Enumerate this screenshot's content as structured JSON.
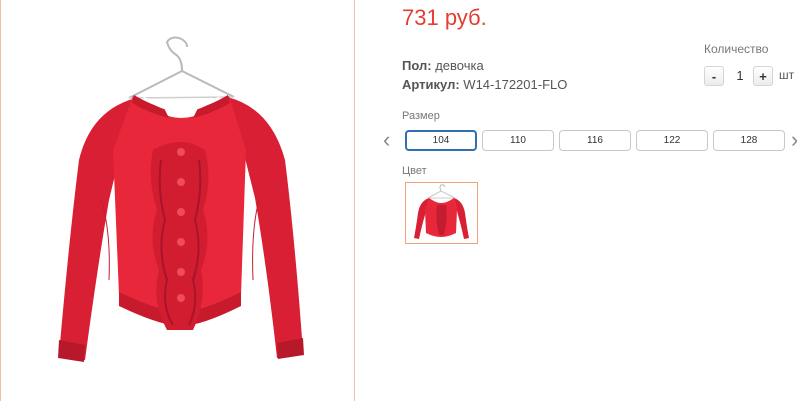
{
  "product": {
    "price": "731 руб.",
    "properties": [
      {
        "key": "Пол:",
        "value": "девочка"
      },
      {
        "key": "Артикул:",
        "value": "W14-172201-FLO"
      }
    ]
  },
  "quantity": {
    "label": "Количество",
    "minus": "-",
    "value": "1",
    "plus": "+",
    "unit": "шт"
  },
  "sizes": {
    "label": "Размер",
    "items": [
      "104",
      "110",
      "116",
      "122",
      "128"
    ],
    "selected": "104",
    "prev_arrow": "‹",
    "next_arrow": "›"
  },
  "colors": {
    "label": "Цвет",
    "items": [
      {
        "name": "red",
        "hex": "#e8283a"
      }
    ]
  },
  "theme": {
    "price_color": "#e53d31",
    "selected_border": "#2f70b4",
    "panel_border": "#f0c2a6",
    "garment_color": "#e8283a"
  }
}
